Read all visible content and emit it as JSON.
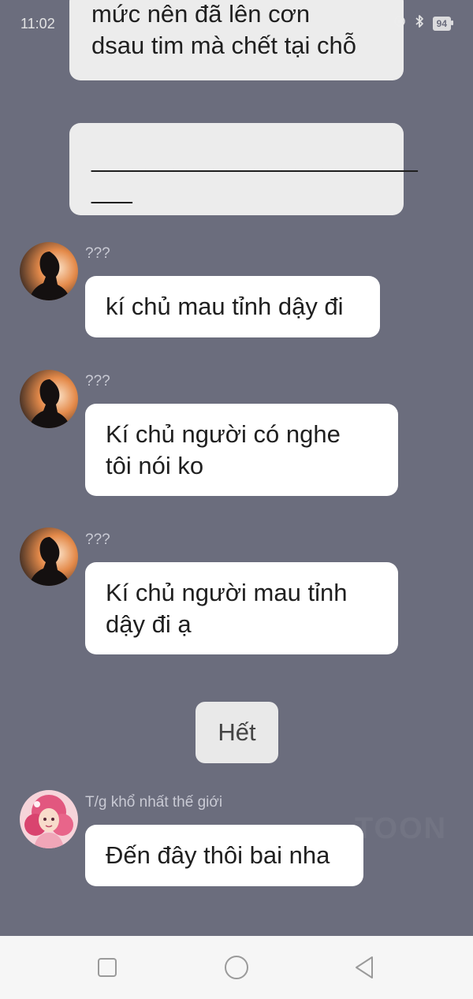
{
  "status_bar": {
    "time": "11:02",
    "battery": "94"
  },
  "messages": {
    "narration_1_lines": [
      "mức nên đã lên cơn",
      "dsau tim mà chết tại chỗ"
    ],
    "narration_2_lines": [
      "________________________",
      "___"
    ],
    "msg1": {
      "sender": "???",
      "lines": [
        "kí chủ mau tỉnh dậy đi"
      ]
    },
    "msg2": {
      "sender": "???",
      "lines": [
        "Kí chủ người có nghe",
        "tôi nói ko"
      ]
    },
    "msg3": {
      "sender": "???",
      "lines": [
        "Kí chủ người mau tỉnh",
        "dậy đi ạ"
      ]
    },
    "end_label": "Hết",
    "msg4": {
      "sender": "T/g khổ nhất thế giới",
      "lines": [
        "Đến đây thôi bai nha"
      ]
    }
  },
  "watermark": "TOON",
  "colors": {
    "background": "#6b6d7d",
    "narration_bubble": "#ececec",
    "message_bubble": "#ffffff",
    "nav_bar": "#f6f6f6"
  },
  "icons": {
    "nav": [
      "recent-apps-icon",
      "home-icon",
      "back-icon"
    ],
    "status": [
      "location-icon",
      "bluetooth-icon",
      "battery-icon"
    ]
  }
}
